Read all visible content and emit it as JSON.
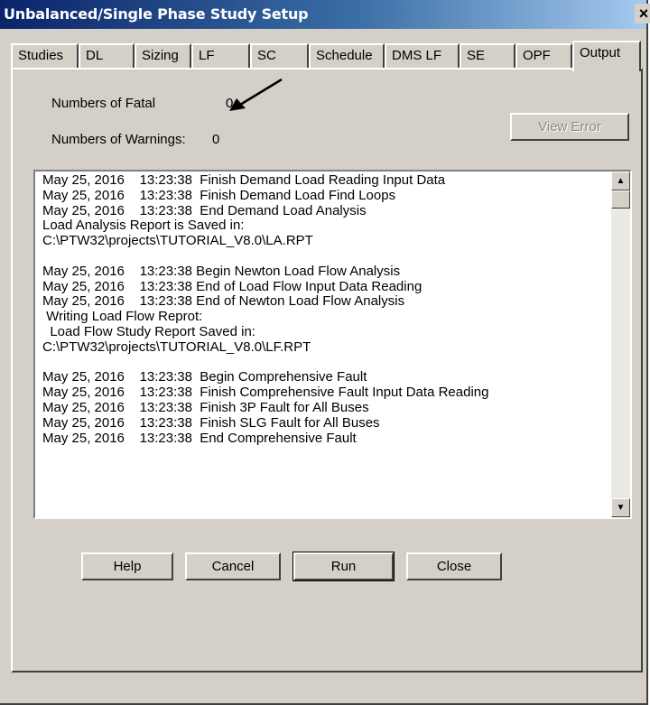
{
  "window": {
    "title": "Unbalanced/Single Phase Study Setup",
    "close_glyph": "×"
  },
  "tabs": [
    {
      "label": "Studies"
    },
    {
      "label": "DL"
    },
    {
      "label": "Sizing"
    },
    {
      "label": "LF"
    },
    {
      "label": "SC"
    },
    {
      "label": "Schedule"
    },
    {
      "label": "DMS LF"
    },
    {
      "label": "SE"
    },
    {
      "label": "OPF"
    },
    {
      "label": "Output"
    }
  ],
  "active_tab": "Output",
  "summary": {
    "fatal_label": "Numbers of Fatal",
    "fatal_value": "0",
    "warnings_label": "Numbers of Warnings:",
    "warnings_value": "0"
  },
  "view_error_label": "View Error",
  "log_lines": [
    "May 25, 2016    13:23:38  Finish Demand Load Reading Input Data",
    "May 25, 2016    13:23:38  Finish Demand Load Find Loops",
    "May 25, 2016    13:23:38  End Demand Load Analysis",
    "Load Analysis Report is Saved in:",
    "C:\\PTW32\\projects\\TUTORIAL_V8.0\\LA.RPT",
    "",
    "May 25, 2016    13:23:38 Begin Newton Load Flow Analysis",
    "May 25, 2016    13:23:38 End of Load Flow Input Data Reading",
    "May 25, 2016    13:23:38 End of Newton Load Flow Analysis",
    " Writing Load Flow Reprot:",
    "  Load Flow Study Report Saved in:",
    "C:\\PTW32\\projects\\TUTORIAL_V8.0\\LF.RPT",
    "",
    "May 25, 2016    13:23:38  Begin Comprehensive Fault",
    "May 25, 2016    13:23:38  Finish Comprehensive Fault Input Data Reading",
    "May 25, 2016    13:23:38  Finish 3P Fault for All Buses",
    "May 25, 2016    13:23:38  Finish SLG Fault for All Buses",
    "May 25, 2016    13:23:38  End Comprehensive Fault"
  ],
  "buttons": {
    "help": "Help",
    "cancel": "Cancel",
    "run": "Run",
    "close": "Close"
  },
  "icons": {
    "scroll_up": "▲",
    "scroll_down": "▼",
    "annotation": "arrow-annotation"
  },
  "colors": {
    "dialog_bg": "#d4d0c8",
    "title_start": "#0a246a",
    "title_end": "#a6caf0",
    "arrow": "#000000"
  }
}
